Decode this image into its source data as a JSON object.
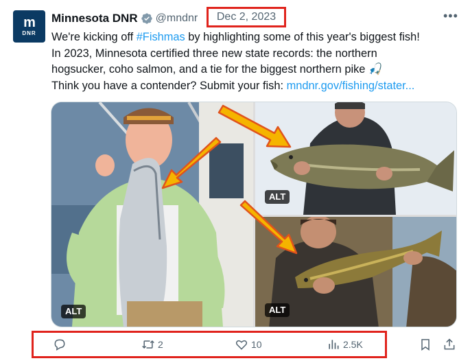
{
  "author": {
    "avatar_top": "m",
    "avatar_bottom": "DNR",
    "name": "Minnesota DNR",
    "handle": "@mndnr",
    "verified_icon": "verified-badge-icon"
  },
  "date": "Dec 2, 2023",
  "more_icon": "more-dots-icon",
  "tweet_lines": [
    {
      "before": "We're kicking off ",
      "hashtag": "#Fishmas",
      "after": " by highlighting some of this year's biggest fish!"
    },
    {
      "text": "In 2023, Minnesota certified three new state records: the northern"
    },
    {
      "text": "hogsucker, coho salmon, and a tie for the biggest northern pike 🎣"
    },
    {
      "before": "Think you have a contender? Submit your fish: ",
      "link": "mndnr.gov/fishing/stater..."
    }
  ],
  "media": {
    "alt_label": "ALT",
    "photos": [
      "man-holding-coho-salmon",
      "man-holding-northern-pike",
      "man-holding-northern-hogsucker"
    ]
  },
  "actions": {
    "reply_count": "",
    "retweet_count": "2",
    "like_count": "10",
    "views_count": "2.5K"
  },
  "colors": {
    "link": "#1d9bf0",
    "highlight_box": "#e0231c",
    "muted": "#536471",
    "arrow_fill": "#f5b400",
    "arrow_outline": "#e0531c"
  }
}
